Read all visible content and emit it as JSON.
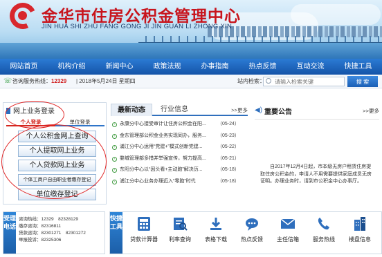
{
  "header": {
    "title": "金华市住房公积金管理中心",
    "pinyin": "JIN HUA SHI ZHU FANG GONG JI JIN GUAN LI ZHONG XIN"
  },
  "nav": {
    "items": [
      "网站首页",
      "机构介绍",
      "新闻中心",
      "政策法规",
      "办事指南",
      "热点反馈",
      "互动交流",
      "快捷工具"
    ]
  },
  "infobar": {
    "hotline_label": "咨询服务热线：",
    "hotline_number": "12329",
    "date": "| 2018年5月24日 星期四",
    "search_label": "站内检索：",
    "search_placeholder": "请输入检索关键",
    "search_button": "搜 索"
  },
  "online": {
    "title": "网上业务登录",
    "tab_personal": "个人登录",
    "tab_unit": "单位登录",
    "buttons": [
      "个人公积金网上查询",
      "个人提取网上业务",
      "个人贷款网上业务",
      "个体工商户自由职业者缴存登记",
      "单位缴存登记"
    ]
  },
  "news": {
    "tab_active": "最新动态",
    "tab_other": "行业信息",
    "more": ">>更多",
    "items": [
      {
        "title": "永康分中心接受审计让住房公积金在阳...",
        "date": "（05-24）"
      },
      {
        "title": "金东管理部公积金业务实现同办，服务...",
        "date": "（05-23）"
      },
      {
        "title": "浦江分中心运用“党建+”模式创新党建...",
        "date": "（05-22）"
      },
      {
        "title": "婺城管理部多措并举强宣传，努力提高...",
        "date": "（05-21）"
      },
      {
        "title": "东阳分中心以“因头看+主动跑”解决历...",
        "date": "（05-18）"
      },
      {
        "title": "浦江分中心业务办理迈入“零跑”时代",
        "date": "（05-18）"
      }
    ]
  },
  "notice": {
    "title": "重要公告",
    "more": ">>更多",
    "text": "自2017年12月4日起，市本级无房户租赁住房提取住房公积金的，申请人不用需要提供家庭成员无房证明。办理业务时，请到市公积金中心办事厅。"
  },
  "hotline_block": {
    "label": "受理电话",
    "lines": [
      "咨询热线：12329　82328129",
      "缴存咨询：82316811",
      "贷款咨询：82301271　82301272",
      "举报投诉：82325306"
    ]
  },
  "quick": {
    "label": "快捷工具",
    "items": [
      {
        "label": "贷款计算器",
        "icon": "calculator-icon"
      },
      {
        "label": "利率查询",
        "icon": "rate-query-icon"
      },
      {
        "label": "表格下载",
        "icon": "download-icon"
      },
      {
        "label": "热点反馈",
        "icon": "feedback-icon"
      },
      {
        "label": "主任信箱",
        "icon": "mail-icon"
      },
      {
        "label": "服务热线",
        "icon": "phone-icon"
      },
      {
        "label": "楼盘信息",
        "icon": "building-icon"
      }
    ]
  },
  "colors": {
    "brand_red": "#c8151d",
    "nav_blue": "#1554a8",
    "accent_green": "#3e9a3e"
  }
}
